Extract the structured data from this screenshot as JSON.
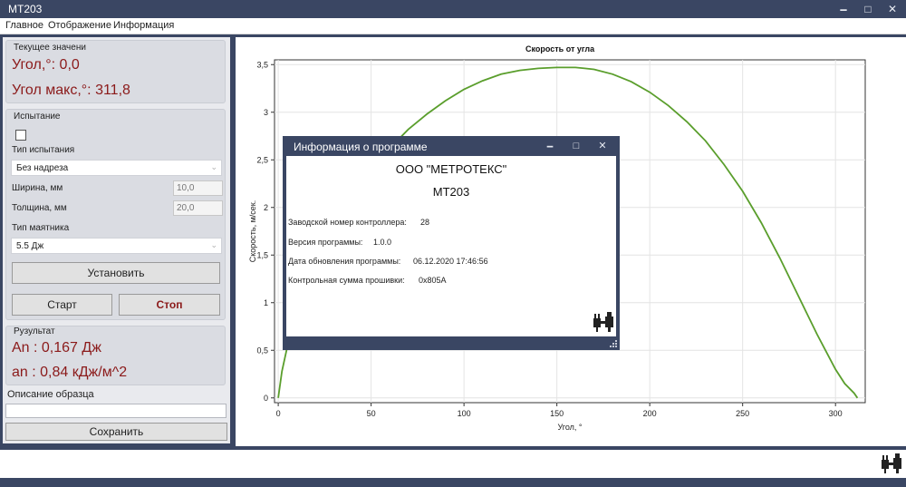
{
  "window": {
    "title": "МТ203",
    "minimize_glyph": "🗕",
    "maximize_glyph": "□",
    "close_glyph": "✕"
  },
  "menu": {
    "items": [
      "Главное",
      "Отображение",
      "Информация"
    ]
  },
  "current_values": {
    "title": "Текущее значени",
    "angle": "Угол,°: 0,0",
    "angle_max": "Угол макс,°: 311,8"
  },
  "test": {
    "title": "Испытание",
    "checked": false,
    "type_label": "Тип испытания",
    "type_value": "Без надреза",
    "width_label": "Ширина, мм",
    "width_value": "10,0",
    "thickness_label": "Толщина, мм",
    "thickness_value": "20,0",
    "pendulum_label": "Тип маятника",
    "pendulum_value": "5.5 Дж",
    "set_button": "Установить",
    "start_button": "Старт",
    "stop_button": "Стоп"
  },
  "result": {
    "title": "Рузультат",
    "an": "An  : 0,167 Дж",
    "an_small": "an  : 0,84 кДж/м^2"
  },
  "sample": {
    "label": "Описание  образца",
    "value": "",
    "save_button": "Сохранить"
  },
  "chart_data": {
    "type": "line",
    "title": "Скорость от угла",
    "xlabel": "Угол, °",
    "ylabel": "Скорость, м/сек.",
    "xlim": [
      -2,
      316
    ],
    "ylim": [
      -0.05,
      3.55
    ],
    "x_ticks": [
      0,
      50,
      100,
      150,
      200,
      250,
      300
    ],
    "y_ticks": [
      0,
      0.5,
      1,
      1.5,
      2,
      2.5,
      3,
      3.5
    ],
    "x_tick_labels": [
      "0",
      "50",
      "100",
      "150",
      "200",
      "250",
      "300"
    ],
    "y_tick_labels": [
      "0",
      "0,5",
      "1",
      "1,5",
      "2",
      "2,5",
      "3",
      "3,5"
    ],
    "grid": true,
    "line_color": "#5a9e2c",
    "series": [
      {
        "x": [
          0,
          2,
          5,
          10,
          20,
          30,
          40,
          50,
          60,
          70,
          80,
          90,
          100,
          110,
          120,
          130,
          140,
          150,
          155,
          160,
          165,
          170,
          180,
          190,
          200,
          210,
          220,
          230,
          240,
          250,
          260,
          270,
          280,
          290,
          300,
          305,
          310,
          311.8
        ],
        "y": [
          0,
          0.28,
          0.55,
          0.95,
          1.45,
          1.85,
          2.15,
          2.4,
          2.62,
          2.82,
          2.98,
          3.12,
          3.24,
          3.33,
          3.4,
          3.44,
          3.46,
          3.47,
          3.47,
          3.47,
          3.46,
          3.45,
          3.4,
          3.32,
          3.21,
          3.07,
          2.9,
          2.7,
          2.45,
          2.17,
          1.84,
          1.47,
          1.07,
          0.67,
          0.3,
          0.15,
          0.05,
          0.0
        ]
      }
    ]
  },
  "info_dialog": {
    "title": "Информация о программе",
    "company": "ООО \"МЕТРОТЕКС\"",
    "model": "МТ203",
    "serial_label": "Заводской номер контроллера:",
    "serial_value": "28",
    "version_label": "Версия программы:",
    "version_value": "1.0.0",
    "update_label": "Дата обновления программы:",
    "update_value": "06.12.2020 17:46:56",
    "checksum_label": "Контрольная сумма прошивки:",
    "checksum_value": "0x805A"
  },
  "colors": {
    "frame": "#3a4663",
    "value_red": "#8b1a1a",
    "curve_green": "#5a9e2c"
  },
  "icons": {
    "connection": "plug-icon"
  }
}
